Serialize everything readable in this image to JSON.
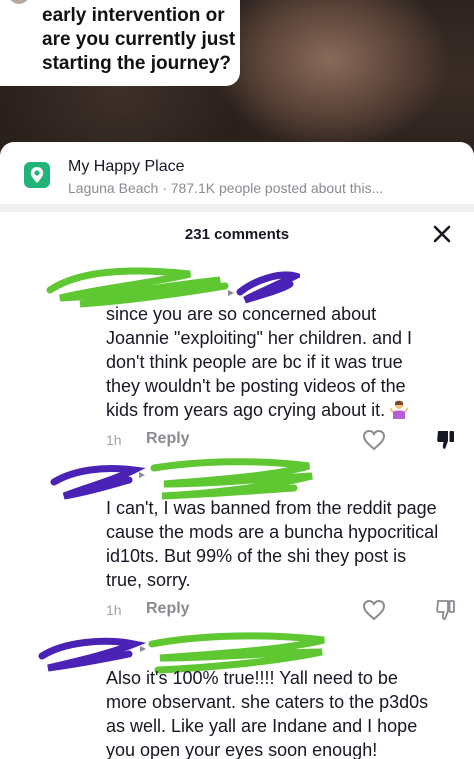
{
  "video": {
    "caption_lines": [
      "early intervention or",
      "are you currently just",
      "starting the journey?"
    ]
  },
  "place": {
    "icon": "location-pin-icon",
    "title": "My Happy Place",
    "subtitle": "Laguna Beach · 787.1K people posted about this..."
  },
  "comments_header": {
    "count_label": "231 comments",
    "close_icon": "close-icon"
  },
  "comments": [
    {
      "lines": [
        "since you are so concerned about",
        "Joannie \"exploiting\" her children. and I",
        "don't think people are bc if it was true",
        "they wouldn't be posting videos of the",
        "kids from years ago crying about it."
      ],
      "emoji": "person-shrugging-emoji",
      "time": "1h",
      "reply": "Reply",
      "disliked": true
    },
    {
      "lines": [
        "I can't, I was banned from the reddit page",
        "cause the mods are a buncha hypocritical",
        "id10ts. But 99% of the shi they post is",
        "true, sorry."
      ],
      "time": "1h",
      "reply": "Reply",
      "disliked": false
    },
    {
      "lines": [
        "Also it's 100% true!!!! Yall need to be",
        "more observant. she caters to the p3d0s",
        "as well. Like yall are Indane and I hope",
        "you open your eyes soon enough!"
      ]
    }
  ],
  "colors": {
    "accent_green": "#20b478",
    "scribble_green": "#5ec732",
    "scribble_purple": "#4a22b5",
    "muted_text": "#8a8b91"
  }
}
